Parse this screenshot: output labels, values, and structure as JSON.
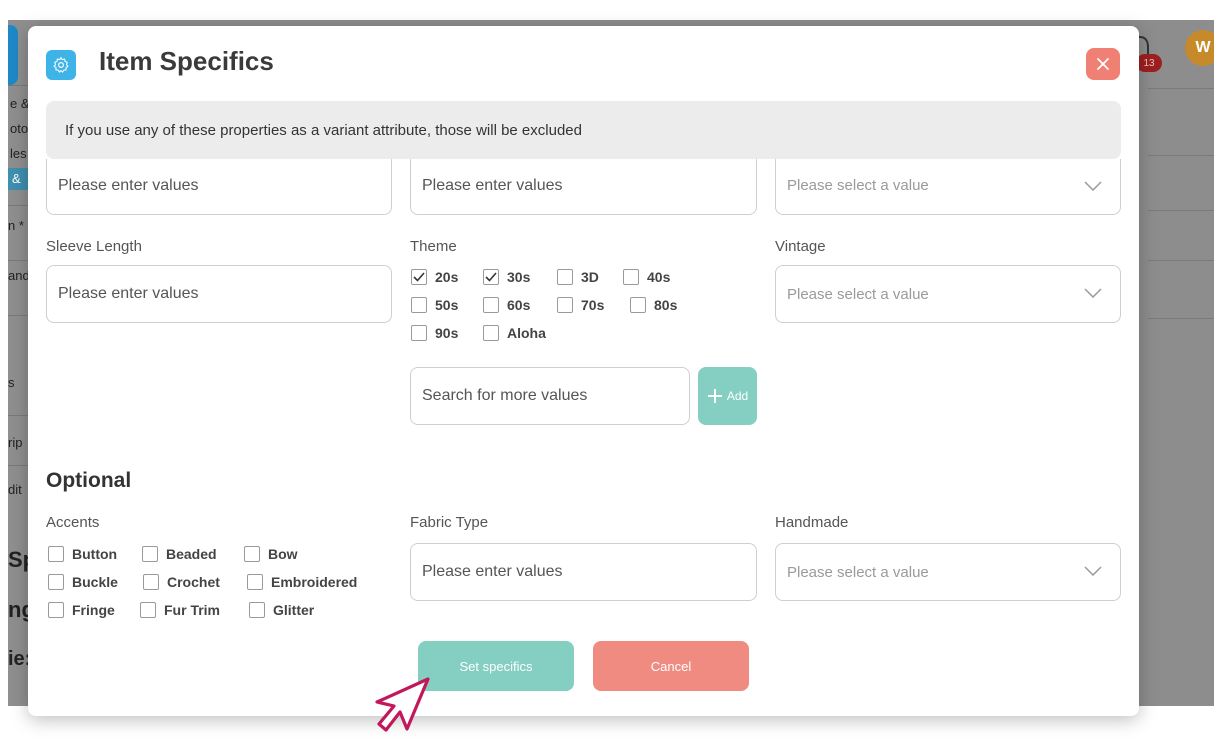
{
  "background": {
    "fragments_left": [
      "e &",
      "oto",
      "les",
      "& ",
      "n *",
      "and",
      "s",
      "rip",
      "dit",
      "Sp",
      "ng",
      "ie:"
    ],
    "avatar_letter": "W",
    "badge_count": "13"
  },
  "modal": {
    "title": "Item Specifics",
    "notice": "If you use any of these properties as a variant attribute, those will be excluded",
    "row1": {
      "col1_placeholder": "Please enter values",
      "col2_placeholder": "Please enter values",
      "col3_placeholder": "Please select a value"
    },
    "row2": {
      "sleeve_length_label": "Sleeve Length",
      "sleeve_length_placeholder": "Please enter values",
      "theme_label": "Theme",
      "theme_options": [
        {
          "label": "20s",
          "checked": true
        },
        {
          "label": "30s",
          "checked": true
        },
        {
          "label": "3D",
          "checked": false
        },
        {
          "label": "40s",
          "checked": false
        },
        {
          "label": "50s",
          "checked": false
        },
        {
          "label": "60s",
          "checked": false
        },
        {
          "label": "70s",
          "checked": false
        },
        {
          "label": "80s",
          "checked": false
        },
        {
          "label": "90s",
          "checked": false
        },
        {
          "label": "Aloha",
          "checked": false
        }
      ],
      "theme_search_placeholder": "Search for more values",
      "add_label": "Add",
      "vintage_label": "Vintage",
      "vintage_placeholder": "Please select a value"
    },
    "optional": {
      "title": "Optional",
      "accents_label": "Accents",
      "accents_options": [
        {
          "label": "Button",
          "checked": false
        },
        {
          "label": "Beaded",
          "checked": false
        },
        {
          "label": "Bow",
          "checked": false
        },
        {
          "label": "Buckle",
          "checked": false
        },
        {
          "label": "Crochet",
          "checked": false
        },
        {
          "label": "Embroidered",
          "checked": false
        },
        {
          "label": "Fringe",
          "checked": false
        },
        {
          "label": "Fur Trim",
          "checked": false
        },
        {
          "label": "Glitter",
          "checked": false
        }
      ],
      "fabric_type_label": "Fabric Type",
      "fabric_type_placeholder": "Please enter values",
      "handmade_label": "Handmade",
      "handmade_placeholder": "Please select a value"
    },
    "buttons": {
      "set_specifics": "Set specifics",
      "cancel": "Cancel"
    }
  },
  "colors": {
    "accent_teal": "#85cfc2",
    "cancel_red": "#f08b82",
    "close_red": "#f07f74",
    "gear_blue": "#3db3e8",
    "cursor_pink": "#c2185b"
  }
}
